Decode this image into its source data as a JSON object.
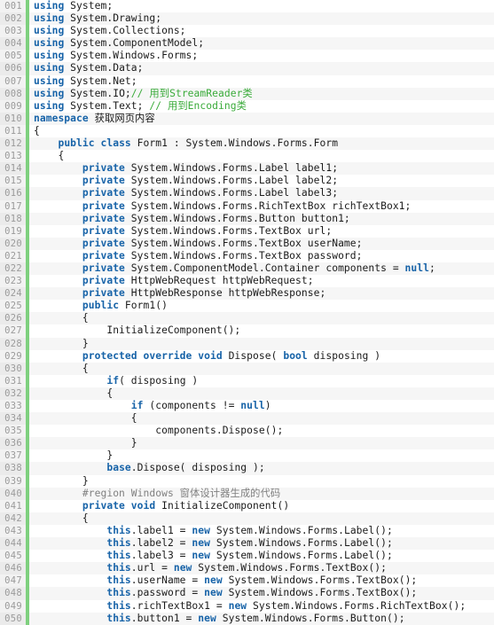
{
  "editor": {
    "language": "csharp",
    "line_number_format": "3-digit-zero-padded",
    "first_line": 1,
    "last_line": 50,
    "total_visible_lines": 50,
    "colors": {
      "background": "#ffffff",
      "alt_row_background": "#f6f6f6",
      "gutter_background": "#f2f2f2",
      "gutter_text": "#9a9a9a",
      "change_marker": "#7ed07e",
      "keyword": "#1763a8",
      "comment": "#3aab3a",
      "preprocessor_region": "#808080",
      "plain_text": "#1a1a1a"
    }
  },
  "lines": [
    {
      "n": "001",
      "tokens": [
        {
          "t": "using",
          "c": "kw"
        },
        {
          "t": " System;",
          "c": "pln"
        }
      ]
    },
    {
      "n": "002",
      "tokens": [
        {
          "t": "using",
          "c": "kw"
        },
        {
          "t": " System.Drawing;",
          "c": "pln"
        }
      ]
    },
    {
      "n": "003",
      "tokens": [
        {
          "t": "using",
          "c": "kw"
        },
        {
          "t": " System.Collections;",
          "c": "pln"
        }
      ]
    },
    {
      "n": "004",
      "tokens": [
        {
          "t": "using",
          "c": "kw"
        },
        {
          "t": " System.ComponentModel;",
          "c": "pln"
        }
      ]
    },
    {
      "n": "005",
      "tokens": [
        {
          "t": "using",
          "c": "kw"
        },
        {
          "t": " System.Windows.Forms;",
          "c": "pln"
        }
      ]
    },
    {
      "n": "006",
      "tokens": [
        {
          "t": "using",
          "c": "kw"
        },
        {
          "t": " System.Data;",
          "c": "pln"
        }
      ]
    },
    {
      "n": "007",
      "tokens": [
        {
          "t": "using",
          "c": "kw"
        },
        {
          "t": " System.Net;",
          "c": "pln"
        }
      ]
    },
    {
      "n": "008",
      "tokens": [
        {
          "t": "using",
          "c": "kw"
        },
        {
          "t": " System.IO;",
          "c": "pln"
        },
        {
          "t": "// 用到StreamReader类",
          "c": "cmt"
        }
      ]
    },
    {
      "n": "009",
      "tokens": [
        {
          "t": "using",
          "c": "kw"
        },
        {
          "t": " System.Text; ",
          "c": "pln"
        },
        {
          "t": "// 用到Encoding类",
          "c": "cmt"
        }
      ]
    },
    {
      "n": "010",
      "tokens": [
        {
          "t": "namespace",
          "c": "kw"
        },
        {
          "t": " 获取网页内容",
          "c": "pln"
        }
      ]
    },
    {
      "n": "011",
      "tokens": [
        {
          "t": "{",
          "c": "pln"
        }
      ]
    },
    {
      "n": "012",
      "tokens": [
        {
          "t": "    ",
          "c": "pln"
        },
        {
          "t": "public class",
          "c": "kw"
        },
        {
          "t": " Form1 : System.Windows.Forms.Form",
          "c": "pln"
        }
      ]
    },
    {
      "n": "013",
      "tokens": [
        {
          "t": "    {",
          "c": "pln"
        }
      ]
    },
    {
      "n": "014",
      "tokens": [
        {
          "t": "        ",
          "c": "pln"
        },
        {
          "t": "private",
          "c": "kw"
        },
        {
          "t": " System.Windows.Forms.Label label1;",
          "c": "pln"
        }
      ]
    },
    {
      "n": "015",
      "tokens": [
        {
          "t": "        ",
          "c": "pln"
        },
        {
          "t": "private",
          "c": "kw"
        },
        {
          "t": " System.Windows.Forms.Label label2;",
          "c": "pln"
        }
      ]
    },
    {
      "n": "016",
      "tokens": [
        {
          "t": "        ",
          "c": "pln"
        },
        {
          "t": "private",
          "c": "kw"
        },
        {
          "t": " System.Windows.Forms.Label label3;",
          "c": "pln"
        }
      ]
    },
    {
      "n": "017",
      "tokens": [
        {
          "t": "        ",
          "c": "pln"
        },
        {
          "t": "private",
          "c": "kw"
        },
        {
          "t": " System.Windows.Forms.RichTextBox richTextBox1;",
          "c": "pln"
        }
      ]
    },
    {
      "n": "018",
      "tokens": [
        {
          "t": "        ",
          "c": "pln"
        },
        {
          "t": "private",
          "c": "kw"
        },
        {
          "t": " System.Windows.Forms.Button button1;",
          "c": "pln"
        }
      ]
    },
    {
      "n": "019",
      "tokens": [
        {
          "t": "        ",
          "c": "pln"
        },
        {
          "t": "private",
          "c": "kw"
        },
        {
          "t": " System.Windows.Forms.TextBox url;",
          "c": "pln"
        }
      ]
    },
    {
      "n": "020",
      "tokens": [
        {
          "t": "        ",
          "c": "pln"
        },
        {
          "t": "private",
          "c": "kw"
        },
        {
          "t": " System.Windows.Forms.TextBox userName;",
          "c": "pln"
        }
      ]
    },
    {
      "n": "021",
      "tokens": [
        {
          "t": "        ",
          "c": "pln"
        },
        {
          "t": "private",
          "c": "kw"
        },
        {
          "t": " System.Windows.Forms.TextBox password;",
          "c": "pln"
        }
      ]
    },
    {
      "n": "022",
      "tokens": [
        {
          "t": "        ",
          "c": "pln"
        },
        {
          "t": "private",
          "c": "kw"
        },
        {
          "t": " System.ComponentModel.Container components = ",
          "c": "pln"
        },
        {
          "t": "null",
          "c": "kw"
        },
        {
          "t": ";",
          "c": "pln"
        }
      ]
    },
    {
      "n": "023",
      "tokens": [
        {
          "t": "        ",
          "c": "pln"
        },
        {
          "t": "private",
          "c": "kw"
        },
        {
          "t": " HttpWebRequest httpWebRequest;",
          "c": "pln"
        }
      ]
    },
    {
      "n": "024",
      "tokens": [
        {
          "t": "        ",
          "c": "pln"
        },
        {
          "t": "private",
          "c": "kw"
        },
        {
          "t": " HttpWebResponse httpWebResponse;",
          "c": "pln"
        }
      ]
    },
    {
      "n": "025",
      "tokens": [
        {
          "t": "        ",
          "c": "pln"
        },
        {
          "t": "public",
          "c": "kw"
        },
        {
          "t": " Form1()",
          "c": "pln"
        }
      ]
    },
    {
      "n": "026",
      "tokens": [
        {
          "t": "        {",
          "c": "pln"
        }
      ]
    },
    {
      "n": "027",
      "tokens": [
        {
          "t": "            InitializeComponent();",
          "c": "pln"
        }
      ]
    },
    {
      "n": "028",
      "tokens": [
        {
          "t": "        }",
          "c": "pln"
        }
      ]
    },
    {
      "n": "029",
      "tokens": [
        {
          "t": "        ",
          "c": "pln"
        },
        {
          "t": "protected override void",
          "c": "kw"
        },
        {
          "t": " Dispose( ",
          "c": "pln"
        },
        {
          "t": "bool",
          "c": "kw"
        },
        {
          "t": " disposing )",
          "c": "pln"
        }
      ]
    },
    {
      "n": "030",
      "tokens": [
        {
          "t": "        {",
          "c": "pln"
        }
      ]
    },
    {
      "n": "031",
      "tokens": [
        {
          "t": "            ",
          "c": "pln"
        },
        {
          "t": "if",
          "c": "kw"
        },
        {
          "t": "( disposing )",
          "c": "pln"
        }
      ]
    },
    {
      "n": "032",
      "tokens": [
        {
          "t": "            {",
          "c": "pln"
        }
      ]
    },
    {
      "n": "033",
      "tokens": [
        {
          "t": "                ",
          "c": "pln"
        },
        {
          "t": "if",
          "c": "kw"
        },
        {
          "t": " (components != ",
          "c": "pln"
        },
        {
          "t": "null",
          "c": "kw"
        },
        {
          "t": ")",
          "c": "pln"
        }
      ]
    },
    {
      "n": "034",
      "tokens": [
        {
          "t": "                {",
          "c": "pln"
        }
      ]
    },
    {
      "n": "035",
      "tokens": [
        {
          "t": "                    components.Dispose();",
          "c": "pln"
        }
      ]
    },
    {
      "n": "036",
      "tokens": [
        {
          "t": "                }",
          "c": "pln"
        }
      ]
    },
    {
      "n": "037",
      "tokens": [
        {
          "t": "            }",
          "c": "pln"
        }
      ]
    },
    {
      "n": "038",
      "tokens": [
        {
          "t": "            ",
          "c": "pln"
        },
        {
          "t": "base",
          "c": "kw"
        },
        {
          "t": ".Dispose( disposing );",
          "c": "pln"
        }
      ]
    },
    {
      "n": "039",
      "tokens": [
        {
          "t": "        }",
          "c": "pln"
        }
      ]
    },
    {
      "n": "040",
      "tokens": [
        {
          "t": "        #region Windows 窗体设计器生成的代码",
          "c": "reg"
        }
      ]
    },
    {
      "n": "041",
      "tokens": [
        {
          "t": "        ",
          "c": "pln"
        },
        {
          "t": "private void",
          "c": "kw"
        },
        {
          "t": " InitializeComponent()",
          "c": "pln"
        }
      ]
    },
    {
      "n": "042",
      "tokens": [
        {
          "t": "        {",
          "c": "pln"
        }
      ]
    },
    {
      "n": "043",
      "tokens": [
        {
          "t": "            ",
          "c": "pln"
        },
        {
          "t": "this",
          "c": "kw"
        },
        {
          "t": ".label1 = ",
          "c": "pln"
        },
        {
          "t": "new",
          "c": "kw"
        },
        {
          "t": " System.Windows.Forms.Label();",
          "c": "pln"
        }
      ]
    },
    {
      "n": "044",
      "tokens": [
        {
          "t": "            ",
          "c": "pln"
        },
        {
          "t": "this",
          "c": "kw"
        },
        {
          "t": ".label2 = ",
          "c": "pln"
        },
        {
          "t": "new",
          "c": "kw"
        },
        {
          "t": " System.Windows.Forms.Label();",
          "c": "pln"
        }
      ]
    },
    {
      "n": "045",
      "tokens": [
        {
          "t": "            ",
          "c": "pln"
        },
        {
          "t": "this",
          "c": "kw"
        },
        {
          "t": ".label3 = ",
          "c": "pln"
        },
        {
          "t": "new",
          "c": "kw"
        },
        {
          "t": " System.Windows.Forms.Label();",
          "c": "pln"
        }
      ]
    },
    {
      "n": "046",
      "tokens": [
        {
          "t": "            ",
          "c": "pln"
        },
        {
          "t": "this",
          "c": "kw"
        },
        {
          "t": ".url = ",
          "c": "pln"
        },
        {
          "t": "new",
          "c": "kw"
        },
        {
          "t": " System.Windows.Forms.TextBox();",
          "c": "pln"
        }
      ]
    },
    {
      "n": "047",
      "tokens": [
        {
          "t": "            ",
          "c": "pln"
        },
        {
          "t": "this",
          "c": "kw"
        },
        {
          "t": ".userName = ",
          "c": "pln"
        },
        {
          "t": "new",
          "c": "kw"
        },
        {
          "t": " System.Windows.Forms.TextBox();",
          "c": "pln"
        }
      ]
    },
    {
      "n": "048",
      "tokens": [
        {
          "t": "            ",
          "c": "pln"
        },
        {
          "t": "this",
          "c": "kw"
        },
        {
          "t": ".password = ",
          "c": "pln"
        },
        {
          "t": "new",
          "c": "kw"
        },
        {
          "t": " System.Windows.Forms.TextBox();",
          "c": "pln"
        }
      ]
    },
    {
      "n": "049",
      "tokens": [
        {
          "t": "            ",
          "c": "pln"
        },
        {
          "t": "this",
          "c": "kw"
        },
        {
          "t": ".richTextBox1 = ",
          "c": "pln"
        },
        {
          "t": "new",
          "c": "kw"
        },
        {
          "t": " System.Windows.Forms.RichTextBox();",
          "c": "pln"
        }
      ]
    },
    {
      "n": "050",
      "tokens": [
        {
          "t": "            ",
          "c": "pln"
        },
        {
          "t": "this",
          "c": "kw"
        },
        {
          "t": ".button1 = ",
          "c": "pln"
        },
        {
          "t": "new",
          "c": "kw"
        },
        {
          "t": " System.Windows.Forms.Button();",
          "c": "pln"
        }
      ]
    }
  ]
}
